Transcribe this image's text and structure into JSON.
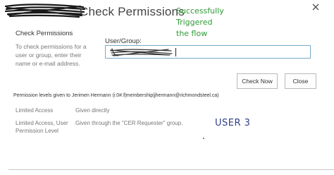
{
  "dialog": {
    "title": "Check Permissions",
    "close_icon": "close-icon"
  },
  "annotation": {
    "line1": "Successfully Triggered",
    "line2": "the flow",
    "color": "#2e9b35"
  },
  "left_panel": {
    "heading": "Check Permissions",
    "description": "To check permissions for a user or group, enter their name or e-mail address."
  },
  "form": {
    "label": "User/Group:",
    "value": ""
  },
  "buttons": {
    "check_now": "Check Now",
    "close": "Close"
  },
  "results": {
    "title": "Permission levels given to Jerimen Hermann (i:0#.f|membership|jhermann@richmondsteel.ca)",
    "rows": [
      {
        "level": "Limited Access",
        "reason": "Given directly"
      },
      {
        "level": "Limited Access, User Permission Level",
        "reason": "Given through the \"CER Requester\" group."
      }
    ]
  },
  "overlay_label": {
    "text": "USER 3",
    "color": "#2f3f86"
  }
}
